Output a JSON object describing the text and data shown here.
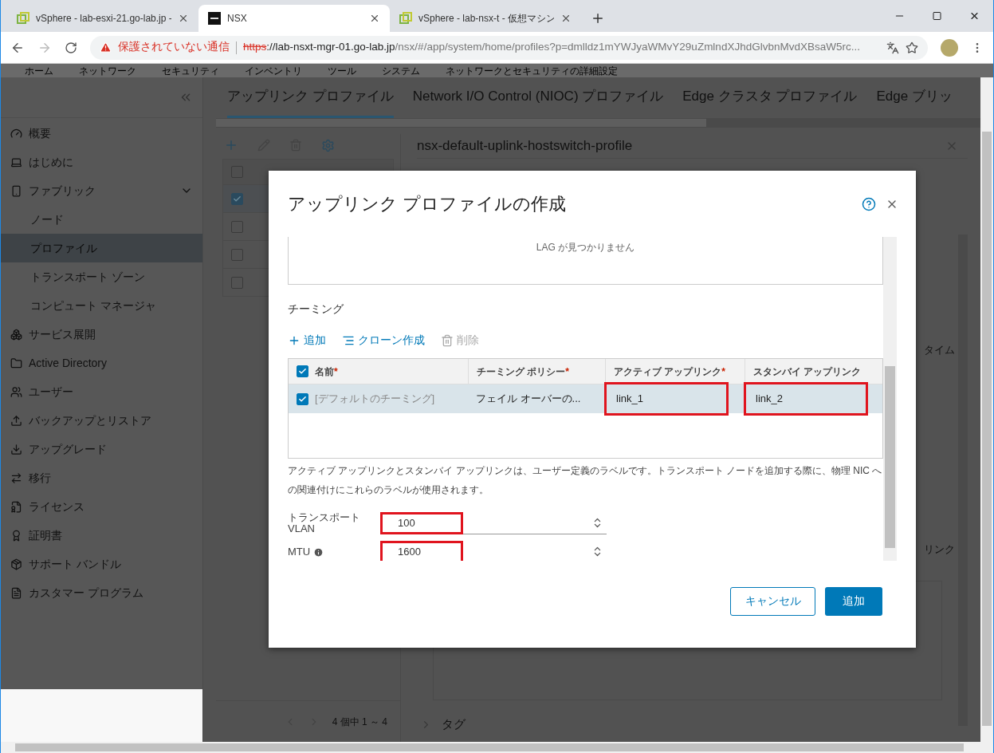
{
  "browser": {
    "tabs": [
      {
        "title": "vSphere - lab-esxi-21.go-lab.jp -",
        "kind": "vsphere",
        "selected": false
      },
      {
        "title": "NSX",
        "kind": "nsx",
        "selected": true
      },
      {
        "title": "vSphere - lab-nsx-t - 仮想マシン",
        "kind": "vsphere",
        "selected": false
      }
    ],
    "address": {
      "warning": "保護されていない通信",
      "scheme": "https",
      "host": "://lab-nsxt-mgr-01.go-lab.jp",
      "path": "/nsx/#/app/system/home/profiles?p=dmlldz1mYWJyaWMvY29uZmlndXJhdGlvbnMvdXBsaW5rc..."
    }
  },
  "nav": [
    "ホーム",
    "ネットワーク",
    "セキュリティ",
    "インベントリ",
    "ツール",
    "システム",
    "ネットワークとセキュリティの詳細設定"
  ],
  "sidebar": {
    "items": [
      {
        "label": "概要",
        "selected": false
      },
      {
        "label": "はじめに",
        "selected": false
      },
      {
        "label": "ファブリック",
        "selected": false,
        "expanded": true,
        "children": [
          {
            "label": "ノード",
            "selected": false
          },
          {
            "label": "プロファイル",
            "selected": true
          },
          {
            "label": "トランスポート ゾーン",
            "selected": false
          },
          {
            "label": "コンピュート マネージャ",
            "selected": false
          }
        ]
      },
      {
        "label": "サービス展開",
        "selected": false
      },
      {
        "label": "Active Directory",
        "selected": false
      },
      {
        "label": "ユーザー",
        "selected": false
      },
      {
        "label": "バックアップとリストア",
        "selected": false
      },
      {
        "label": "アップグレード",
        "selected": false
      },
      {
        "label": "移行",
        "selected": false
      },
      {
        "label": "ライセンス",
        "selected": false
      },
      {
        "label": "証明書",
        "selected": false
      },
      {
        "label": "サポート バンドル",
        "selected": false
      },
      {
        "label": "カスタマー プログラム",
        "selected": false
      }
    ]
  },
  "profile_tabs": [
    {
      "label": "アップリンク プロファイル",
      "selected": true
    },
    {
      "label": "Network I/O Control (NIOC) プロファイル",
      "selected": false
    },
    {
      "label": "Edge クラスタ プロファイル",
      "selected": false
    },
    {
      "label": "Edge ブリッ",
      "selected": false
    }
  ],
  "list": {
    "header_checked": false,
    "rows": [
      {
        "checked": true
      },
      {
        "checked": false
      },
      {
        "checked": false
      },
      {
        "checked": false
      }
    ],
    "pagination": "4 個中 1 ～ 4"
  },
  "detail": {
    "title": "nsx-default-uplink-hostswitch-profile",
    "fragment_1": "タイム",
    "fragment_2": "リンク",
    "section": "タグ"
  },
  "dialog": {
    "title": "アップリンク プロファイルの作成",
    "lag_empty": "LAG が見つかりません",
    "teaming": {
      "title": "チーミング",
      "actions": [
        {
          "label": "追加",
          "kind": "add",
          "disabled": false
        },
        {
          "label": "クローン作成",
          "kind": "clone",
          "disabled": false
        },
        {
          "label": "削除",
          "kind": "delete",
          "disabled": true
        }
      ],
      "all_checked": true,
      "columns": [
        {
          "label": "名前",
          "mark": "*"
        },
        {
          "label": "チーミング ポリシー",
          "mark": "*"
        },
        {
          "label": "アクティブ アップリンク",
          "mark": "*"
        },
        {
          "label": "スタンバイ アップリンク"
        }
      ],
      "rows": [
        {
          "selected": true,
          "cells": [
            {
              "text": "[デフォルトのチーミング]",
              "highlighted": false
            },
            {
              "text": "フェイル オーバーの...",
              "highlighted": false
            },
            {
              "text": "link_1",
              "highlighted": true
            },
            {
              "text": "link_2",
              "highlighted": true
            }
          ]
        }
      ],
      "note": "アクティブ アップリンクとスタンバイ アップリンクは、ユーザー定義のラベルです。トランスポート ノードを追加する際に、物理 NIC への関連付けにこれらのラベルが使用されます。"
    },
    "fields": [
      {
        "label": "トランスポート VLAN",
        "value": "100",
        "info": false,
        "highlighted": true
      },
      {
        "label": "MTU",
        "value": "1600",
        "info": true,
        "highlighted": true
      }
    ],
    "buttons": [
      {
        "label": "キャンセル",
        "kind": "secondary"
      },
      {
        "label": "追加",
        "kind": "primary"
      }
    ]
  }
}
